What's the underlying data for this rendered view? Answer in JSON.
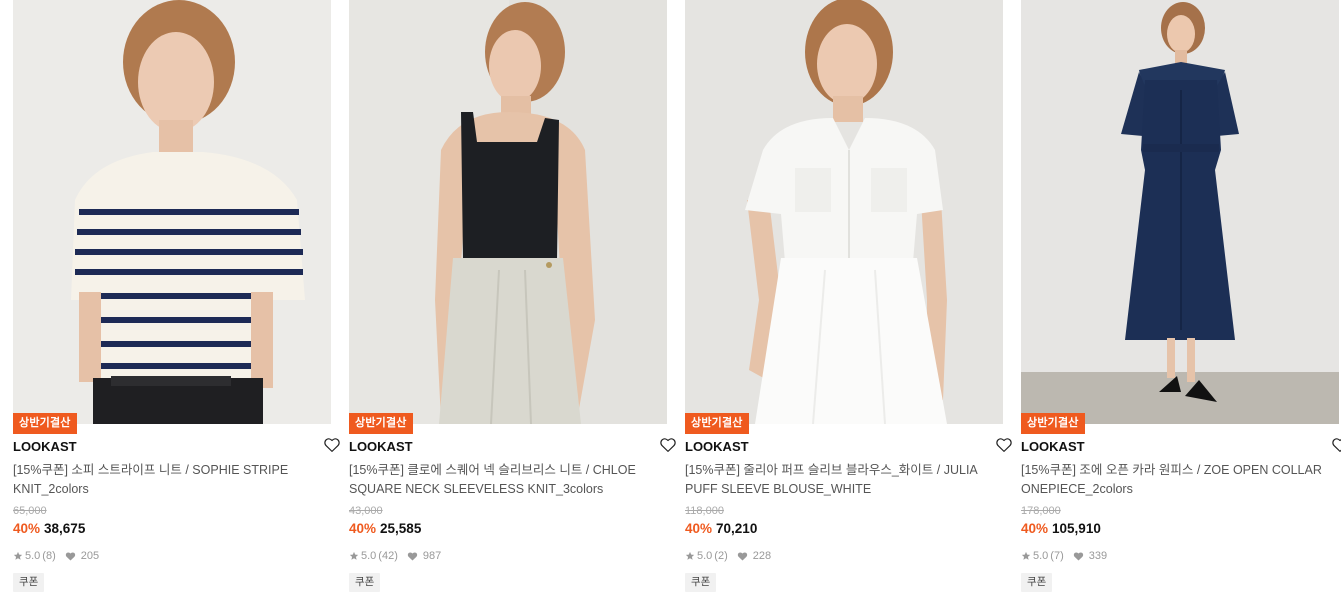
{
  "products": [
    {
      "badge": "상반기결산",
      "brand": "LOOKAST",
      "name": "[15%쿠폰] 소피 스트라이프 니트 / SOPHIE STRIPE KNIT_2colors",
      "original_price": "65,000",
      "discount": "40%",
      "price": "38,675",
      "rating": "5.0",
      "reviews": "(8)",
      "likes": "205",
      "coupon": "쿠폰"
    },
    {
      "badge": "상반기결산",
      "brand": "LOOKAST",
      "name": "[15%쿠폰] 클로에 스퀘어 넥 슬리브리스 니트 / CHLOE SQUARE NECK SLEEVELESS KNIT_3colors",
      "original_price": "43,000",
      "discount": "40%",
      "price": "25,585",
      "rating": "5.0",
      "reviews": "(42)",
      "likes": "987",
      "coupon": "쿠폰"
    },
    {
      "badge": "상반기결산",
      "brand": "LOOKAST",
      "name": "[15%쿠폰] 줄리아 퍼프 슬리브 블라우스_화이트 / JULIA PUFF SLEEVE BLOUSE_WHITE",
      "original_price": "118,000",
      "discount": "40%",
      "price": "70,210",
      "rating": "5.0",
      "reviews": "(2)",
      "likes": "228",
      "coupon": "쿠폰"
    },
    {
      "badge": "상반기결산",
      "brand": "LOOKAST",
      "name": "[15%쿠폰] 조에 오픈 카라 원피스 / ZOE OPEN COLLAR ONEPIECE_2colors",
      "original_price": "178,000",
      "discount": "40%",
      "price": "105,910",
      "rating": "5.0",
      "reviews": "(7)",
      "likes": "339",
      "coupon": "쿠폰"
    }
  ],
  "icons": {
    "wishlist": "heart-outline-icon",
    "rating": "star-icon",
    "likes": "heart-filled-icon"
  },
  "colors": {
    "accent": "#ef5a1f",
    "text": "#111111",
    "muted": "#999999"
  }
}
